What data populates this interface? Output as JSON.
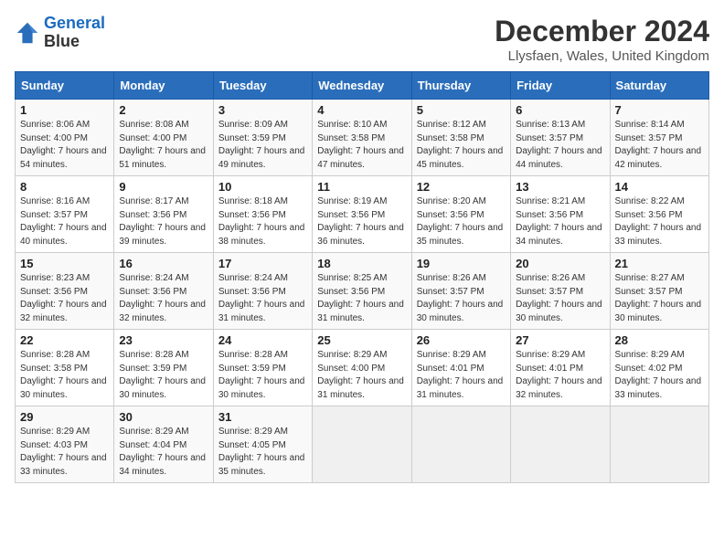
{
  "header": {
    "logo_line1": "General",
    "logo_line2": "Blue",
    "title": "December 2024",
    "subtitle": "Llysfaen, Wales, United Kingdom"
  },
  "days_of_week": [
    "Sunday",
    "Monday",
    "Tuesday",
    "Wednesday",
    "Thursday",
    "Friday",
    "Saturday"
  ],
  "weeks": [
    [
      {
        "day": "1",
        "info": "Sunrise: 8:06 AM\nSunset: 4:00 PM\nDaylight: 7 hours and 54 minutes."
      },
      {
        "day": "2",
        "info": "Sunrise: 8:08 AM\nSunset: 4:00 PM\nDaylight: 7 hours and 51 minutes."
      },
      {
        "day": "3",
        "info": "Sunrise: 8:09 AM\nSunset: 3:59 PM\nDaylight: 7 hours and 49 minutes."
      },
      {
        "day": "4",
        "info": "Sunrise: 8:10 AM\nSunset: 3:58 PM\nDaylight: 7 hours and 47 minutes."
      },
      {
        "day": "5",
        "info": "Sunrise: 8:12 AM\nSunset: 3:58 PM\nDaylight: 7 hours and 45 minutes."
      },
      {
        "day": "6",
        "info": "Sunrise: 8:13 AM\nSunset: 3:57 PM\nDaylight: 7 hours and 44 minutes."
      },
      {
        "day": "7",
        "info": "Sunrise: 8:14 AM\nSunset: 3:57 PM\nDaylight: 7 hours and 42 minutes."
      }
    ],
    [
      {
        "day": "8",
        "info": "Sunrise: 8:16 AM\nSunset: 3:57 PM\nDaylight: 7 hours and 40 minutes."
      },
      {
        "day": "9",
        "info": "Sunrise: 8:17 AM\nSunset: 3:56 PM\nDaylight: 7 hours and 39 minutes."
      },
      {
        "day": "10",
        "info": "Sunrise: 8:18 AM\nSunset: 3:56 PM\nDaylight: 7 hours and 38 minutes."
      },
      {
        "day": "11",
        "info": "Sunrise: 8:19 AM\nSunset: 3:56 PM\nDaylight: 7 hours and 36 minutes."
      },
      {
        "day": "12",
        "info": "Sunrise: 8:20 AM\nSunset: 3:56 PM\nDaylight: 7 hours and 35 minutes."
      },
      {
        "day": "13",
        "info": "Sunrise: 8:21 AM\nSunset: 3:56 PM\nDaylight: 7 hours and 34 minutes."
      },
      {
        "day": "14",
        "info": "Sunrise: 8:22 AM\nSunset: 3:56 PM\nDaylight: 7 hours and 33 minutes."
      }
    ],
    [
      {
        "day": "15",
        "info": "Sunrise: 8:23 AM\nSunset: 3:56 PM\nDaylight: 7 hours and 32 minutes."
      },
      {
        "day": "16",
        "info": "Sunrise: 8:24 AM\nSunset: 3:56 PM\nDaylight: 7 hours and 32 minutes."
      },
      {
        "day": "17",
        "info": "Sunrise: 8:24 AM\nSunset: 3:56 PM\nDaylight: 7 hours and 31 minutes."
      },
      {
        "day": "18",
        "info": "Sunrise: 8:25 AM\nSunset: 3:56 PM\nDaylight: 7 hours and 31 minutes."
      },
      {
        "day": "19",
        "info": "Sunrise: 8:26 AM\nSunset: 3:57 PM\nDaylight: 7 hours and 30 minutes."
      },
      {
        "day": "20",
        "info": "Sunrise: 8:26 AM\nSunset: 3:57 PM\nDaylight: 7 hours and 30 minutes."
      },
      {
        "day": "21",
        "info": "Sunrise: 8:27 AM\nSunset: 3:57 PM\nDaylight: 7 hours and 30 minutes."
      }
    ],
    [
      {
        "day": "22",
        "info": "Sunrise: 8:28 AM\nSunset: 3:58 PM\nDaylight: 7 hours and 30 minutes."
      },
      {
        "day": "23",
        "info": "Sunrise: 8:28 AM\nSunset: 3:59 PM\nDaylight: 7 hours and 30 minutes."
      },
      {
        "day": "24",
        "info": "Sunrise: 8:28 AM\nSunset: 3:59 PM\nDaylight: 7 hours and 30 minutes."
      },
      {
        "day": "25",
        "info": "Sunrise: 8:29 AM\nSunset: 4:00 PM\nDaylight: 7 hours and 31 minutes."
      },
      {
        "day": "26",
        "info": "Sunrise: 8:29 AM\nSunset: 4:01 PM\nDaylight: 7 hours and 31 minutes."
      },
      {
        "day": "27",
        "info": "Sunrise: 8:29 AM\nSunset: 4:01 PM\nDaylight: 7 hours and 32 minutes."
      },
      {
        "day": "28",
        "info": "Sunrise: 8:29 AM\nSunset: 4:02 PM\nDaylight: 7 hours and 33 minutes."
      }
    ],
    [
      {
        "day": "29",
        "info": "Sunrise: 8:29 AM\nSunset: 4:03 PM\nDaylight: 7 hours and 33 minutes."
      },
      {
        "day": "30",
        "info": "Sunrise: 8:29 AM\nSunset: 4:04 PM\nDaylight: 7 hours and 34 minutes."
      },
      {
        "day": "31",
        "info": "Sunrise: 8:29 AM\nSunset: 4:05 PM\nDaylight: 7 hours and 35 minutes."
      },
      {
        "day": "",
        "info": ""
      },
      {
        "day": "",
        "info": ""
      },
      {
        "day": "",
        "info": ""
      },
      {
        "day": "",
        "info": ""
      }
    ]
  ]
}
